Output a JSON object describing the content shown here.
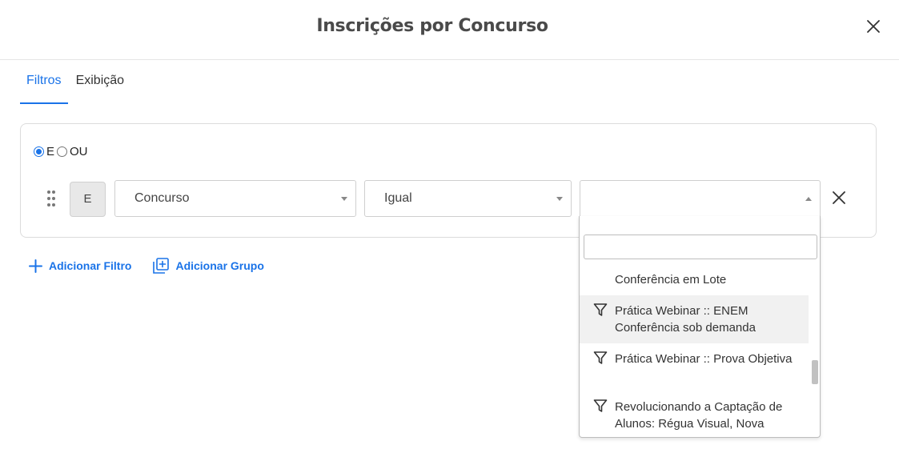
{
  "modal": {
    "title": "Inscrições por Concurso",
    "close_icon": "close-icon"
  },
  "tabs": [
    {
      "label": "Filtros",
      "active": true
    },
    {
      "label": "Exibição",
      "active": false
    }
  ],
  "logic": {
    "options": [
      {
        "label": "E",
        "checked": true
      },
      {
        "label": "OU",
        "checked": false
      }
    ]
  },
  "filter_row": {
    "group_badge": "E",
    "field": {
      "value": "Concurso"
    },
    "operator": {
      "value": "Igual"
    },
    "value": {
      "value": ""
    }
  },
  "actions": {
    "add_filter": "Adicionar Filtro",
    "add_group": "Adicionar Grupo"
  },
  "dropdown": {
    "search_value": "",
    "items": [
      {
        "label": "Conferência em Lote",
        "icon": "filter-icon"
      },
      {
        "label": "Prática Webinar :: ENEM Conferência sob demanda",
        "icon": "filter-icon",
        "highlighted": true
      },
      {
        "label": "Prática Webinar :: Prova Objetiva",
        "icon": "filter-icon"
      },
      {
        "label": "Revolucionando a Captação de Alunos: Régua Visual, Nova",
        "icon": "filter-icon"
      }
    ]
  },
  "colors": {
    "accent": "#1a73e8",
    "highlight": "#f1f1f1",
    "border": "#cfcfcf"
  }
}
